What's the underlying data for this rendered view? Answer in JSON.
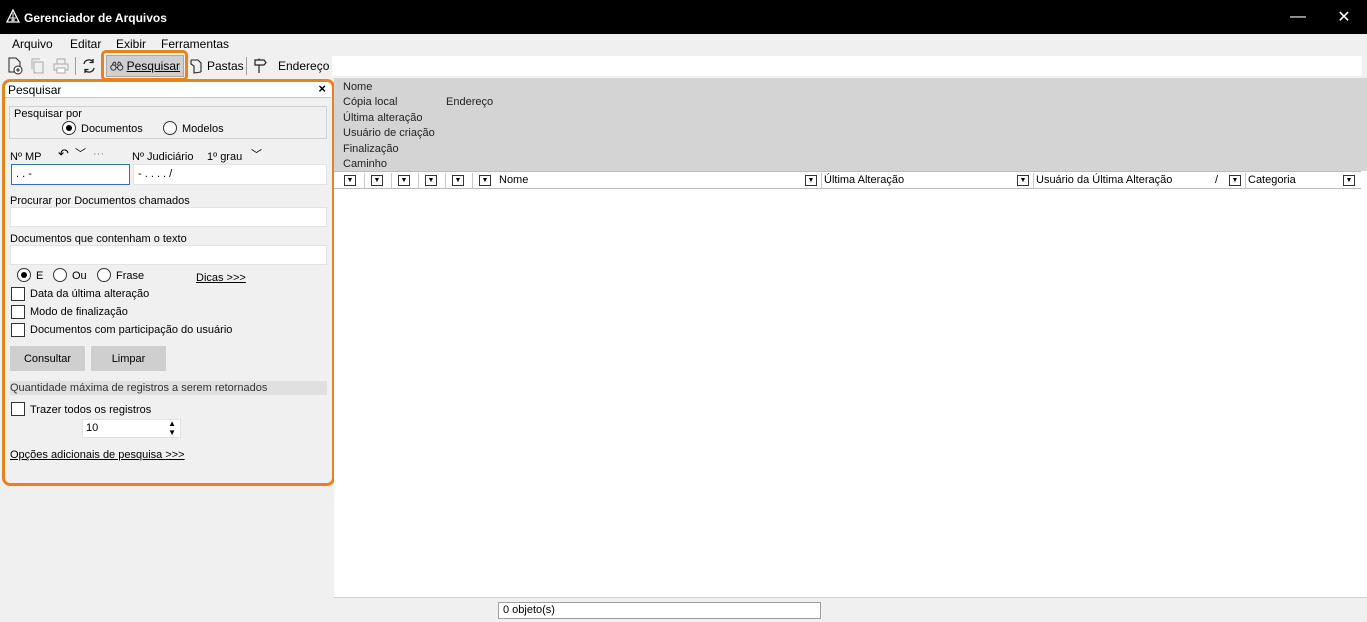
{
  "window": {
    "title": "Gerenciador de Arquivos",
    "minimize": "—",
    "close": "✕"
  },
  "menu": {
    "items": [
      "Arquivo",
      "Editar",
      "Exibir",
      "Ferramentas"
    ]
  },
  "toolbar": {
    "pesquisar": "Pesquisar",
    "pastas": "Pastas",
    "endereco": "Endereço",
    "address_value": ""
  },
  "search_panel": {
    "title": "Pesquisar",
    "close": "×",
    "search_by_label": "Pesquisar por",
    "opt_documentos": "Documentos",
    "opt_modelos": "Modelos",
    "selected_search_by": "Documentos",
    "nmp_label": "Nº MP",
    "nmp_value": " .   .      -",
    "nmp_dots": "···",
    "njud_label": "Nº Judiciário",
    "njud_value": "        -  .    .  .  .      /",
    "grau_label": "1º grau",
    "doc_name_label": "Procurar por Documentos chamados",
    "doc_name_value": "",
    "text_label": "Documentos que contenham o texto",
    "text_value": "",
    "opt_e": "E",
    "opt_ou": "Ou",
    "opt_frase": "Frase",
    "selected_logic": "E",
    "dicas": "Dicas >>>",
    "chk_data": "Data da última alteração",
    "chk_modo": "Modo de finalização",
    "chk_participacao": "Documentos com participação do usuário",
    "btn_consultar": "Consultar",
    "btn_limpar": "Limpar",
    "max_label": "Quantidade máxima de registros a serem retornados",
    "chk_todos": "Trazer todos os registros",
    "max_value": "10",
    "more_options": "Opções adicionais de pesquisa >>>"
  },
  "details": {
    "nome": "Nome",
    "copia_local": "Cópia local",
    "endereco": "Endereço",
    "ultima_alteracao": "Última alteração",
    "usuario_criacao": "Usuário de criação",
    "finalizacao": "Finalização",
    "caminho": "Caminho"
  },
  "columns": {
    "nome": "Nome",
    "ultima_alteracao": "Última Alteração",
    "usuario_ultima_alteracao": "Usuário da Última Alteração",
    "sort_indicator": "/",
    "categoria": "Categoria"
  },
  "status": {
    "count": "0 objeto(s)"
  },
  "colors": {
    "highlight": "#e8821e",
    "titlebar": "#000000"
  }
}
